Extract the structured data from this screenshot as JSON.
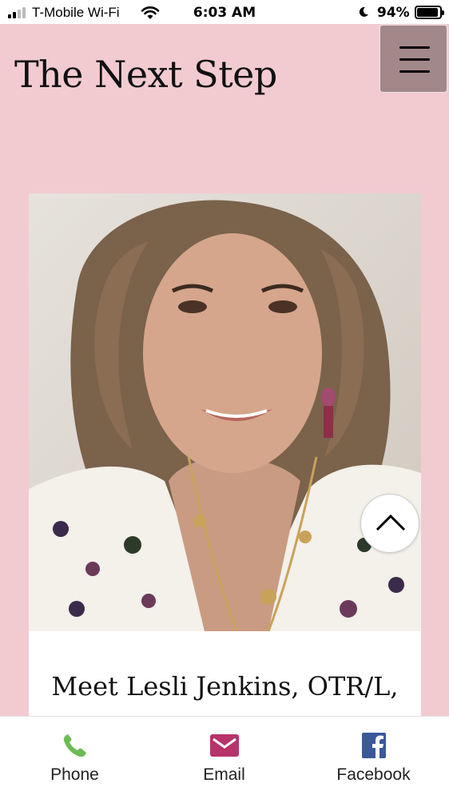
{
  "status_bar": {
    "carrier": "T-Mobile Wi-Fi",
    "time": "6:03 AM",
    "battery": "94%"
  },
  "header": {
    "title": "The Next Step"
  },
  "card": {
    "heading": "Meet Lesli Jenkins, OTR/L,"
  },
  "bottom_bar": {
    "items": [
      {
        "label": "Phone",
        "icon": "phone-icon",
        "color": "#6dbb55"
      },
      {
        "label": "Email",
        "icon": "envelope-icon",
        "color": "#b8336a"
      },
      {
        "label": "Facebook",
        "icon": "facebook-icon",
        "color": "#3b5998"
      }
    ]
  },
  "colors": {
    "page_background": "#f2cbd1",
    "menu_button": "#a3888a"
  }
}
